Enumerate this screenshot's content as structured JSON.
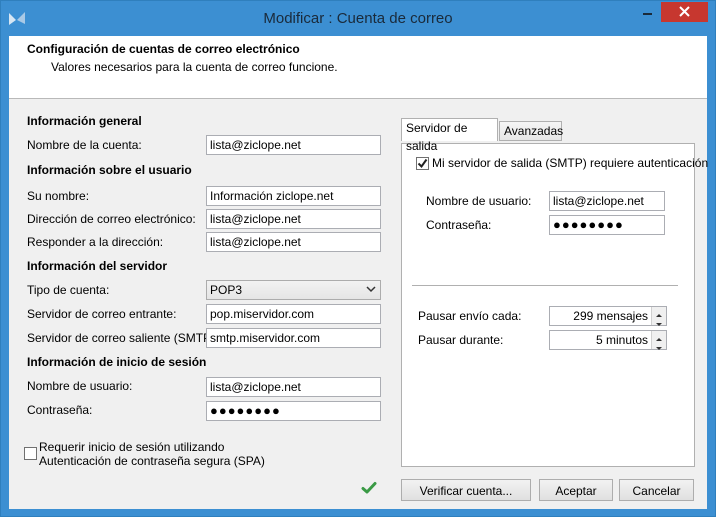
{
  "window": {
    "title": "Modificar : Cuenta de correo"
  },
  "header": {
    "title": "Configuración de cuentas de correo electrónico",
    "subtitle": "Valores necesarios para la cuenta de correo funcione."
  },
  "general": {
    "section": "Información general",
    "account_name_label": "Nombre de la cuenta:",
    "account_name_value": "lista@ziclope.net"
  },
  "user": {
    "section": "Información sobre el usuario",
    "name_label": "Su nombre:",
    "name_value": "Información ziclope.net",
    "email_label": "Dirección de correo electrónico:",
    "email_value": "lista@ziclope.net",
    "reply_label": "Responder a la dirección:",
    "reply_value": "lista@ziclope.net"
  },
  "server": {
    "section": "Información del servidor",
    "type_label": "Tipo de cuenta:",
    "type_value": "POP3",
    "incoming_label": "Servidor de correo entrante:",
    "incoming_value": "pop.miservidor.com",
    "outgoing_label": "Servidor de correo saliente (SMTP):",
    "outgoing_value": "smtp.miservidor.com"
  },
  "login": {
    "section": "Información de inicio de sesión",
    "user_label": "Nombre de usuario:",
    "user_value": "lista@ziclope.net",
    "password_label": "Contraseña:",
    "password_value": "●●●●●●●●"
  },
  "spa": {
    "line1": "Requerir inicio de sesión utilizando",
    "line2": "Autenticación de contraseña segura (SPA)",
    "checked": false
  },
  "tabs": {
    "outgoing": "Servidor de salida",
    "advanced": "Avanzadas"
  },
  "outgoing_tab": {
    "auth_label": "Mi servidor de salida (SMTP) requiere autenticación",
    "auth_checked": true,
    "user_label": "Nombre de usuario:",
    "user_value": "lista@ziclope.net",
    "password_label": "Contraseña:",
    "password_value": "●●●●●●●●",
    "pause_every_label": "Pausar envío cada:",
    "pause_every_value": "299 mensajes",
    "pause_for_label": "Pausar durante:",
    "pause_for_value": "5 minutos"
  },
  "buttons": {
    "verify": "Verificar cuenta...",
    "accept": "Aceptar",
    "cancel": "Cancelar"
  },
  "colors": {
    "titlebar": "#3c8fd2",
    "close": "#c7372f",
    "check_green": "#3a9a45"
  }
}
